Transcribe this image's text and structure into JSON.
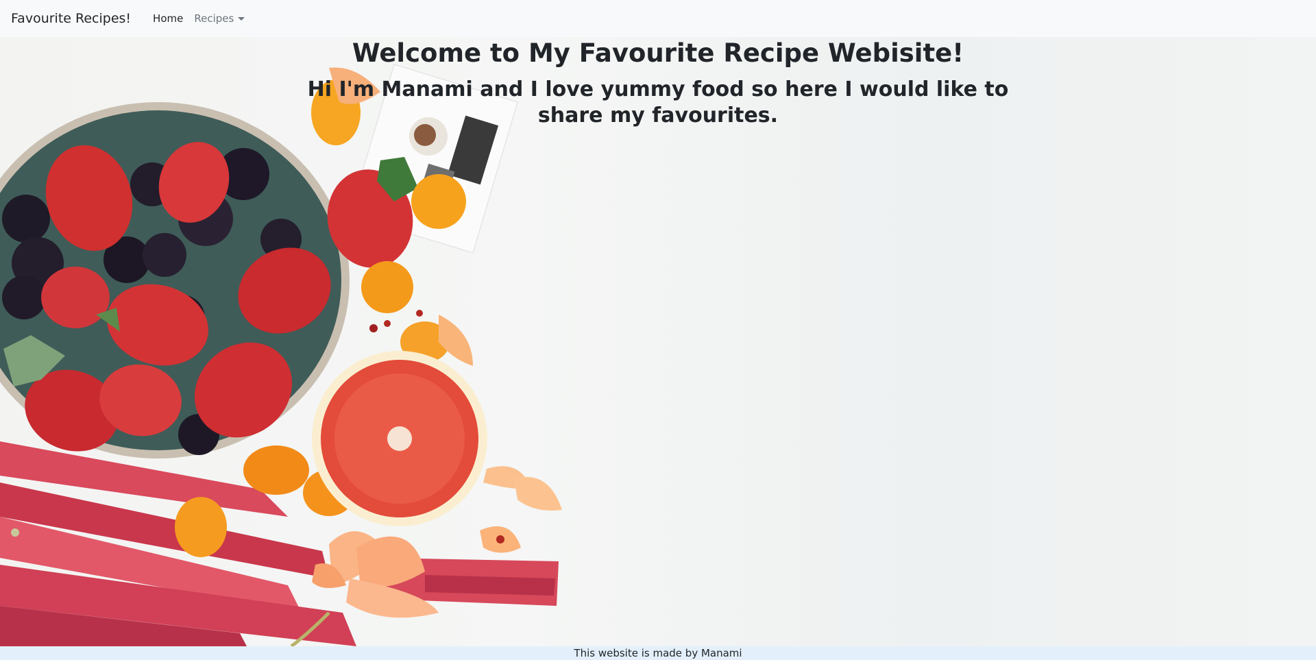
{
  "navbar": {
    "brand": "Favourite Recipes!",
    "home_label": "Home",
    "recipes_label": "Recipes"
  },
  "hero": {
    "title": "Welcome to My Favourite Recipe Webisite!",
    "subtitle": "Hi I'm Manami and I love yummy food so here I would like to share my favourites."
  },
  "footer": {
    "text": "This website is made by Manami"
  },
  "colors": {
    "navbar_bg": "#f8f9fa",
    "footer_bg": "#e3f0fb",
    "text": "#212529",
    "muted": "#6c757d"
  }
}
